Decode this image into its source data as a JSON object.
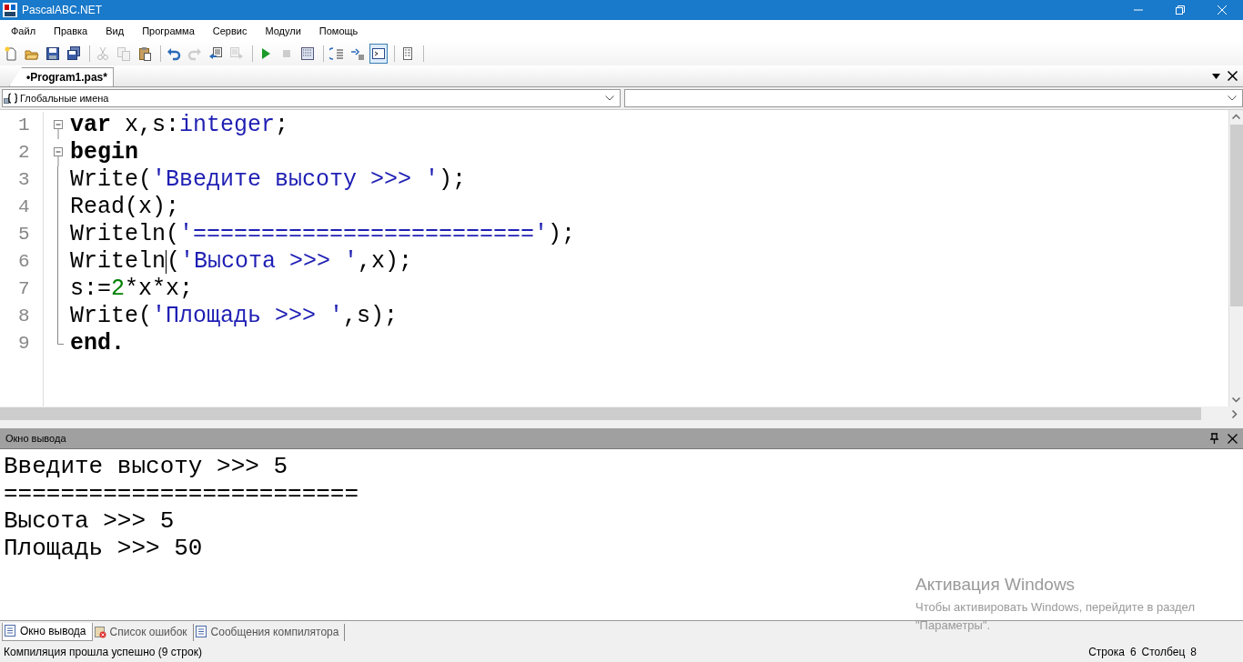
{
  "window": {
    "title": "PascalABC.NET"
  },
  "menu": [
    "Файл",
    "Правка",
    "Вид",
    "Программа",
    "Сервис",
    "Модули",
    "Помощь"
  ],
  "toolbar": [
    {
      "kind": "new",
      "disabled": false,
      "selected": false
    },
    {
      "kind": "open",
      "disabled": false,
      "selected": false
    },
    {
      "kind": "save",
      "disabled": false,
      "selected": false
    },
    {
      "kind": "saveall",
      "disabled": false,
      "selected": false
    },
    {
      "kind": "separator"
    },
    {
      "kind": "cut",
      "disabled": true,
      "selected": false
    },
    {
      "kind": "copy",
      "disabled": true,
      "selected": false
    },
    {
      "kind": "paste",
      "disabled": false,
      "selected": false
    },
    {
      "kind": "separator"
    },
    {
      "kind": "undo",
      "disabled": false,
      "selected": false
    },
    {
      "kind": "redo",
      "disabled": true,
      "selected": false
    },
    {
      "kind": "back",
      "disabled": false,
      "selected": false
    },
    {
      "kind": "forward",
      "disabled": true,
      "selected": false
    },
    {
      "kind": "separator"
    },
    {
      "kind": "run",
      "disabled": false,
      "selected": false
    },
    {
      "kind": "stop",
      "disabled": true,
      "selected": false
    },
    {
      "kind": "build",
      "disabled": false,
      "selected": false
    },
    {
      "kind": "separator"
    },
    {
      "kind": "stepin",
      "disabled": false,
      "selected": false
    },
    {
      "kind": "stepover",
      "disabled": false,
      "selected": false
    },
    {
      "kind": "console",
      "disabled": false,
      "selected": true
    },
    {
      "kind": "separator"
    },
    {
      "kind": "form",
      "disabled": false,
      "selected": false
    },
    {
      "kind": "separator"
    }
  ],
  "document_tabs": [
    {
      "label": "•Program1.pas*",
      "selected": true
    }
  ],
  "scope_dropdown": {
    "value": "Глобальные имена"
  },
  "code_lines": [
    {
      "number": "1",
      "kind": "opener",
      "tokens": [
        {
          "kind": "keyword",
          "text": "var"
        },
        {
          "kind": "plain",
          "text": " x,s:"
        },
        {
          "kind": "type",
          "text": "integer"
        },
        {
          "kind": "plain",
          "text": ";"
        }
      ]
    },
    {
      "number": "2",
      "kind": "opener",
      "tokens": [
        {
          "kind": "keyword",
          "text": "begin"
        }
      ]
    },
    {
      "number": "3",
      "kind": "body",
      "tokens": [
        {
          "kind": "plain",
          "text": "Write("
        },
        {
          "kind": "string",
          "text": "'Введите высоту >>> '"
        },
        {
          "kind": "plain",
          "text": ");"
        }
      ]
    },
    {
      "number": "4",
      "kind": "body",
      "tokens": [
        {
          "kind": "plain",
          "text": "Read(x);"
        }
      ]
    },
    {
      "number": "5",
      "kind": "body",
      "tokens": [
        {
          "kind": "plain",
          "text": "Writeln("
        },
        {
          "kind": "string",
          "text": "'========================='"
        },
        {
          "kind": "plain",
          "text": ");"
        }
      ]
    },
    {
      "number": "6",
      "kind": "body",
      "tokens": [
        {
          "kind": "plain",
          "text": "Writeln"
        },
        {
          "kind": "plain",
          "text": "(",
          "caret_before": true
        },
        {
          "kind": "string",
          "text": "'Высота >>> '"
        },
        {
          "kind": "plain",
          "text": ",x);"
        }
      ]
    },
    {
      "number": "7",
      "kind": "body",
      "tokens": [
        {
          "kind": "plain",
          "text": "s:="
        },
        {
          "kind": "number",
          "text": "2"
        },
        {
          "kind": "plain",
          "text": "*x*x;"
        }
      ]
    },
    {
      "number": "8",
      "kind": "body",
      "tokens": [
        {
          "kind": "plain",
          "text": "Write("
        },
        {
          "kind": "string",
          "text": "'Площадь >>> '"
        },
        {
          "kind": "plain",
          "text": ",s);"
        }
      ]
    },
    {
      "number": "9",
      "kind": "closer",
      "tokens": [
        {
          "kind": "keyword",
          "text": "end."
        }
      ]
    }
  ],
  "output_panel": {
    "title": "Окно вывода",
    "lines": [
      "Введите высоту >>> 5",
      "=========================",
      "Высота >>> 5",
      "Площадь >>> 50"
    ]
  },
  "bottom_tabs": [
    {
      "label": "Окно вывода",
      "kind": "output",
      "selected": true
    },
    {
      "label": "Список ошибок",
      "kind": "errors",
      "selected": false
    },
    {
      "label": "Сообщения компилятора",
      "kind": "messages",
      "selected": false
    }
  ],
  "status_bar": {
    "message": "Компиляция прошла успешно (9 строк)",
    "row_label": "Строка",
    "row": "6",
    "col_label": "Столбец",
    "col": "8"
  },
  "activation_notice": {
    "title": "Активация Windows",
    "text": "Чтобы активировать Windows, перейдите в раздел \"Параметры\"."
  }
}
